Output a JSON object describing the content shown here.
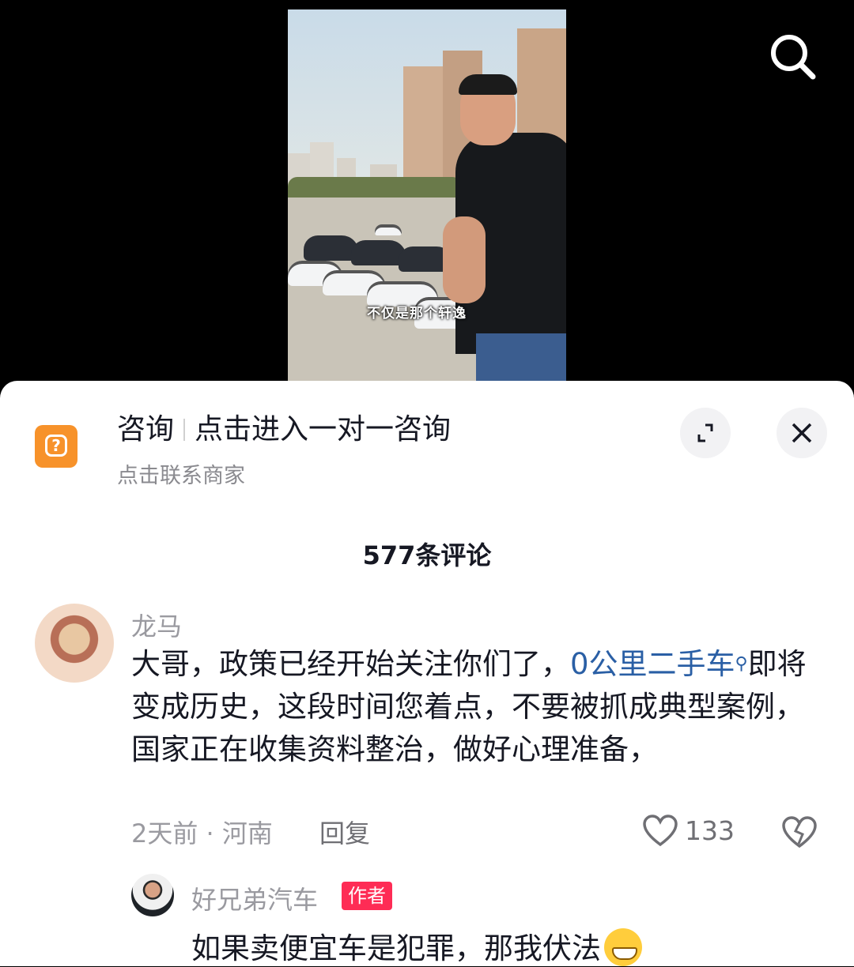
{
  "video": {
    "subtitle": "不仅是那个轩逸"
  },
  "header": {
    "search_icon": "search-icon"
  },
  "consult": {
    "title_main": "咨询",
    "title_action": "点击进入一对一咨询",
    "subtitle": "点击联系商家",
    "icon": "question-icon",
    "accent": "#f7922a",
    "expand_icon": "expand-icon",
    "close_icon": "close-icon"
  },
  "comments_count_label": "577条评论",
  "comments": [
    {
      "username": "龙马",
      "text_before_link": "大哥，政策已经开始关注你们了，",
      "link_text": "0公里二手车",
      "text_after_link": "即将变成历史，这段时间您着点，不要被抓成典型案例，国家正在收集资料整治，做好心理准备，",
      "meta": "2天前 · 河南",
      "reply_label": "回复",
      "like_count": "133"
    }
  ],
  "reply": {
    "username": "好兄弟汽车",
    "badge": "作者",
    "badge_color": "#fe2c55",
    "text": "如果卖便宜车是犯罪，那我伏法",
    "emoji": "grin-emoji"
  }
}
